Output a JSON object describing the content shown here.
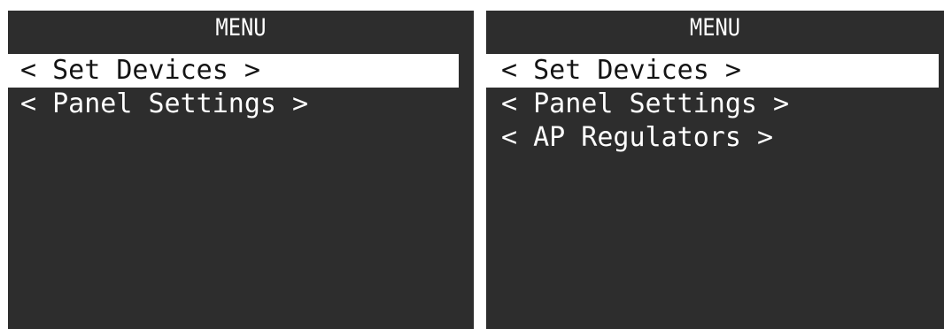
{
  "screens": [
    {
      "title": "MENU",
      "items": [
        {
          "label": "< Set Devices >",
          "selected": true
        },
        {
          "label": "< Panel Settings >",
          "selected": false
        }
      ]
    },
    {
      "title": "MENU",
      "items": [
        {
          "label": "< Set Devices >",
          "selected": true
        },
        {
          "label": "< Panel Settings >",
          "selected": false
        },
        {
          "label": "< AP Regulators >",
          "selected": false
        }
      ]
    }
  ],
  "colors": {
    "screen_background": "#2d2d2d",
    "text": "#ffffff",
    "selected_background": "#ffffff",
    "selected_text": "#141414"
  }
}
